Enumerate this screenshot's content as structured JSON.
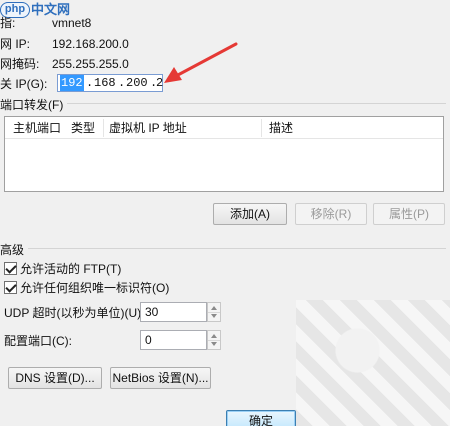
{
  "watermark": {
    "badge": "php",
    "text": "中文网"
  },
  "fields": {
    "name_label": "指:",
    "name_value": "vmnet8",
    "subnet_ip_label": "网 IP:",
    "subnet_ip_value": "192.168.200.0",
    "subnet_mask_label": "网掩码:",
    "subnet_mask_value": "255.255.255.0",
    "gateway_label": "关 IP(G):",
    "gateway_value": {
      "octet1": "192",
      "octet2": "168",
      "octet3": "200",
      "octet4": "2",
      "dot": "."
    }
  },
  "port_forwarding": {
    "title": "端口转发(F)",
    "columns": [
      "主机端口",
      "类型",
      "虚拟机 IP 地址",
      "描述"
    ],
    "add_label": "添加(A)",
    "remove_label": "移除(R)",
    "properties_label": "属性(P)"
  },
  "advanced": {
    "title": "高级",
    "allow_ftp_label": "允许活动的 FTP(T)",
    "allow_ftp_checked": true,
    "allow_oui_label": "允许任何组织唯一标识符(O)",
    "allow_oui_checked": true,
    "udp_timeout_label": "UDP 超时(以秒为单位)(U):",
    "udp_timeout_value": "30",
    "config_port_label": "配置端口(C):",
    "config_port_value": "0",
    "dns_button": "DNS 设置(D)...",
    "netbios_button": "NetBios 设置(N)..."
  },
  "footer": {
    "ok_label": "确定"
  },
  "colors": {
    "annotation_arrow": "#e53935",
    "selection": "#3399ff"
  }
}
